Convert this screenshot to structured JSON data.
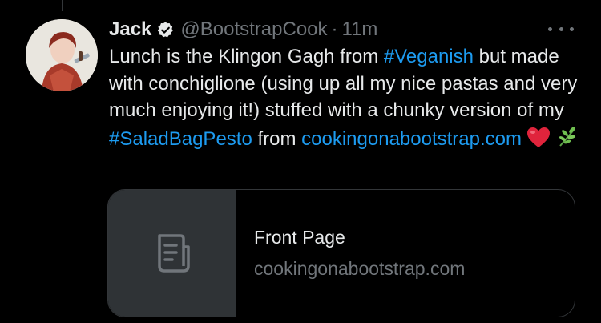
{
  "tweet": {
    "author_name": "Jack",
    "handle": "@BootstrapCook",
    "separator": "·",
    "time": "11m",
    "text_parts": {
      "p1": "Lunch is the Klingon Gagh from ",
      "hashtag1": "#Veganish",
      "p2": " but made with conchiglione (using up all my nice pastas and very much enjoying it!) stuffed with a chunky version of my ",
      "hashtag2": "#SaladBagPesto",
      "p3": " from ",
      "link": "cookingonabootstrap.com"
    },
    "emojis": [
      "heart-emoji",
      "herb-emoji"
    ]
  },
  "card": {
    "title": "Front Page",
    "domain": "cookingonabootstrap.com",
    "icon": "document-icon"
  },
  "colors": {
    "background": "#000000",
    "text": "#e7e9ea",
    "secondary": "#71767b",
    "link": "#1d9bf0",
    "border": "#333639",
    "card_thumb": "#2f3336"
  }
}
